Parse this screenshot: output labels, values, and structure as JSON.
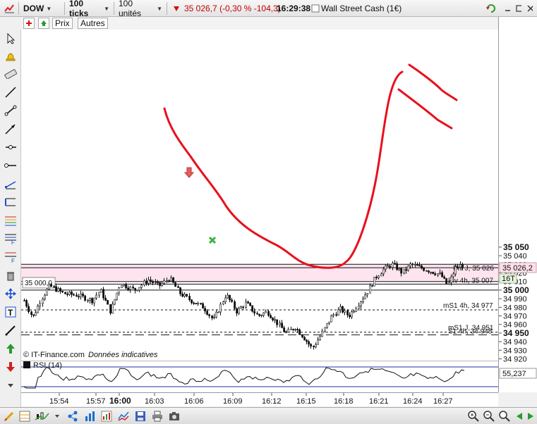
{
  "toolbar": {
    "symbol": "DOW",
    "period": "100 ticks",
    "units": "100 unités",
    "price": "35 026,7",
    "change": "(-0,30 % -104,3)",
    "time": "16:29:38",
    "instrument": "Wall Street Cash (1€)"
  },
  "subbar": {
    "prix": "Prix",
    "autres": "Autres"
  },
  "chart": {
    "copyright": "© IT-Finance.com",
    "disclaimer": "Données indicatives",
    "price_labels": [
      "35 050",
      "35 040",
      "35 030",
      "35 020",
      "35 010",
      "35 000",
      "34 990",
      "34 980",
      "34 970",
      "34 960",
      "34 950",
      "34 940",
      "34 930",
      "34 920"
    ],
    "bold_labels": [
      "35 050",
      "35 000",
      "34 950"
    ],
    "levels": {
      "piv_j": "Piv J, 35 026",
      "piv_4h": "Piv 4h, 35 007",
      "ms1_4h": "mS1 4h, 34 977",
      "ms1_j": "mS1 J, 34 951",
      "s1_4h": "S1 4h, 34 948",
      "box_35000": "35 000,0"
    },
    "current_price_tag": "35 026,2",
    "tick_tag": "16T",
    "time_labels": [
      "15:54",
      "15:57",
      "16:00",
      "16:03",
      "16:06",
      "16:09",
      "16:12",
      "16:15",
      "16:18",
      "16:21",
      "16:24",
      "16:27"
    ],
    "bold_time": "16:00",
    "colors": {
      "pink_zone": "#fde4ef",
      "red_drawing": "#e8101e",
      "price_tag": "#fde0e8",
      "tick_tag": "#e7f5e0"
    }
  },
  "rsi": {
    "label": "RSI (14)",
    "value": "55,237"
  }
}
